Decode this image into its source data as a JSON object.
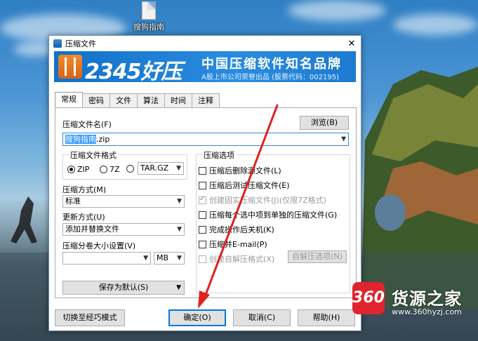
{
  "desktop": {
    "icon_label": "搜狗指南"
  },
  "dialog": {
    "title": "压缩文件",
    "close": "✕",
    "banner": {
      "brand": "2345好压",
      "slogan": "中国压缩软件知名品牌",
      "sub": "A股上市公司荣誉出品 (股票代码：002195)"
    },
    "tabs": [
      "常规",
      "密码",
      "文件",
      "算法",
      "时间",
      "注释"
    ],
    "archive_name_label": "压缩文件名(F)",
    "browse_button": "浏览(B)",
    "archive_name": {
      "selected": "搜狗指南",
      "rest": ".zip"
    },
    "format": {
      "title": "压缩文件格式",
      "options": [
        "ZIP",
        "7Z",
        "TAR.GZ"
      ],
      "selected": "ZIP"
    },
    "method": {
      "label": "压缩方式(M)",
      "value": "标准"
    },
    "update": {
      "label": "更新方式(U)",
      "value": "添加并替换文件"
    },
    "volume": {
      "label": "压缩分卷大小设置(V)",
      "unit": "MB"
    },
    "save_default": "保存为默认(S)",
    "options": {
      "title": "压缩选项",
      "items": [
        {
          "label": "压缩后删除源文件(L)",
          "checked": false,
          "disabled": false
        },
        {
          "label": "压缩后测试压缩文件(E)",
          "checked": false,
          "disabled": false
        },
        {
          "label": "创建固实压缩文件(J)(仅限7Z格式)",
          "checked": true,
          "disabled": true
        },
        {
          "label": "压缩每个选中项到单独的压缩文件(G)",
          "checked": false,
          "disabled": false
        },
        {
          "label": "完成操作后关机(K)",
          "checked": false,
          "disabled": false
        },
        {
          "label": "压缩并E-mail(P)",
          "checked": false,
          "disabled": false
        },
        {
          "label": "创建自解压格式(X)",
          "checked": false,
          "disabled": true
        }
      ],
      "sfx_button": "自解压选项(N)"
    },
    "buttons": {
      "switch": "切换至经巧模式",
      "ok": "确定(O)",
      "cancel": "取消(C)",
      "help": "帮助(H)"
    }
  },
  "watermark": {
    "logo": "360",
    "name": "货源之家",
    "url": "www.360hyzj.com"
  },
  "colors": {
    "banner": "#1a78cf",
    "selection": "#3399ff",
    "arrow": "#e02020",
    "brand_red": "#e0232c"
  }
}
